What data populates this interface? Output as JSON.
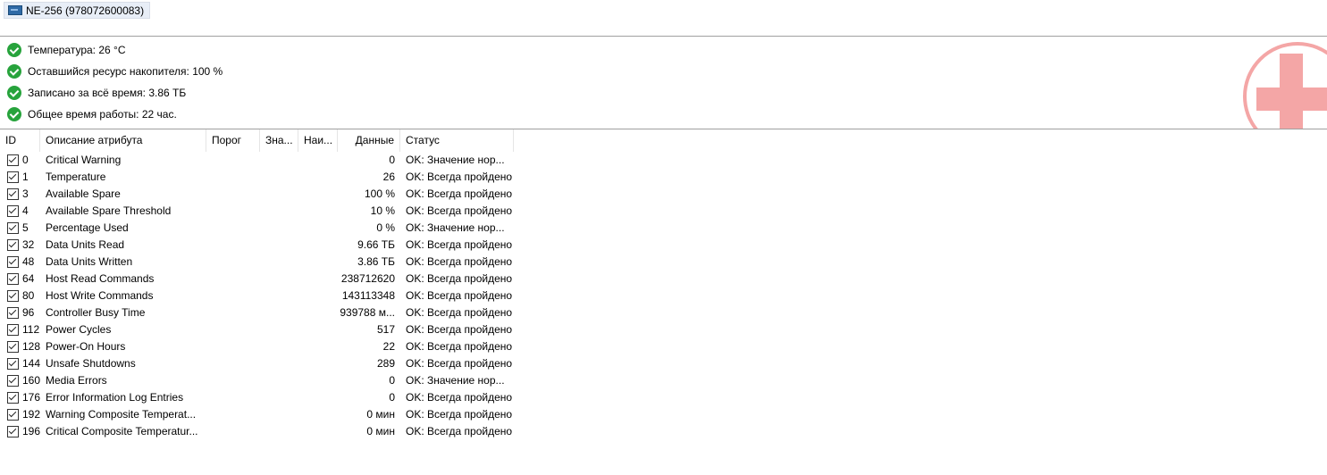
{
  "drive": {
    "label": "NE-256 (978072600083)"
  },
  "summary": [
    {
      "text": "Температура: 26 °C"
    },
    {
      "text": "Оставшийся ресурс накопителя: 100 %"
    },
    {
      "text": "Записано за всё время: 3.86 ТБ"
    },
    {
      "text": "Общее время работы: 22 час."
    }
  ],
  "colors": {
    "ok_green": "#27a33c",
    "health_logo": "#f4a6a6"
  },
  "table": {
    "headers": {
      "id": "ID",
      "description": "Описание атрибута",
      "threshold": "Порог",
      "value": "Зна...",
      "worst": "Наи...",
      "data": "Данные",
      "status": "Статус"
    },
    "rows": [
      {
        "id": "0",
        "description": "Critical Warning",
        "data": "0",
        "status": "OK: Значение нор..."
      },
      {
        "id": "1",
        "description": "Temperature",
        "data": "26",
        "status": "OK: Всегда пройдено"
      },
      {
        "id": "3",
        "description": "Available Spare",
        "data": "100 %",
        "status": "OK: Всегда пройдено"
      },
      {
        "id": "4",
        "description": "Available Spare Threshold",
        "data": "10 %",
        "status": "OK: Всегда пройдено"
      },
      {
        "id": "5",
        "description": "Percentage Used",
        "data": "0 %",
        "status": "OK: Значение нор..."
      },
      {
        "id": "32",
        "description": "Data Units Read",
        "data": "9.66 ТБ",
        "status": "OK: Всегда пройдено"
      },
      {
        "id": "48",
        "description": "Data Units Written",
        "data": "3.86 ТБ",
        "status": "OK: Всегда пройдено"
      },
      {
        "id": "64",
        "description": "Host Read Commands",
        "data": "238712620",
        "status": "OK: Всегда пройдено"
      },
      {
        "id": "80",
        "description": "Host Write Commands",
        "data": "143113348",
        "status": "OK: Всегда пройдено"
      },
      {
        "id": "96",
        "description": "Controller Busy Time",
        "data": "939788 м...",
        "status": "OK: Всегда пройдено"
      },
      {
        "id": "112",
        "description": "Power Cycles",
        "data": "517",
        "status": "OK: Всегда пройдено"
      },
      {
        "id": "128",
        "description": "Power-On Hours",
        "data": "22",
        "status": "OK: Всегда пройдено"
      },
      {
        "id": "144",
        "description": "Unsafe Shutdowns",
        "data": "289",
        "status": "OK: Всегда пройдено"
      },
      {
        "id": "160",
        "description": "Media Errors",
        "data": "0",
        "status": "OK: Значение нор..."
      },
      {
        "id": "176",
        "description": "Error Information Log Entries",
        "data": "0",
        "status": "OK: Всегда пройдено"
      },
      {
        "id": "192",
        "description": "Warning Composite Temperat...",
        "data": "0 мин",
        "status": "OK: Всегда пройдено"
      },
      {
        "id": "196",
        "description": "Critical Composite Temperatur...",
        "data": "0 мин",
        "status": "OK: Всегда пройдено"
      }
    ]
  }
}
